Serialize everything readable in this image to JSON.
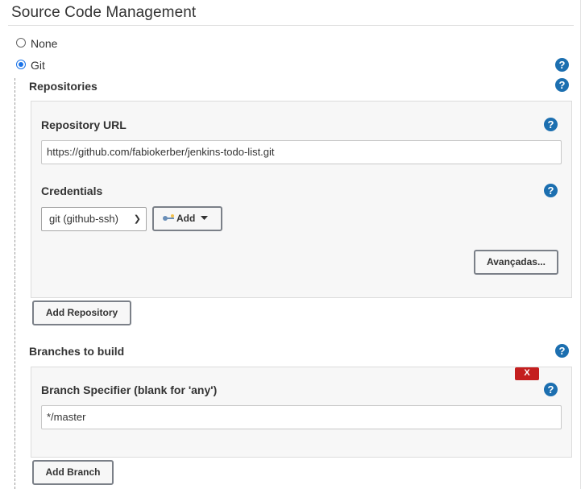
{
  "section": {
    "title": "Source Code Management"
  },
  "scm": {
    "none_label": "None",
    "git_label": "Git",
    "selected": "Git"
  },
  "repositories": {
    "label": "Repositories",
    "url_label": "Repository URL",
    "url_value": "https://github.com/fabiokerber/jenkins-todo-list.git",
    "credentials_label": "Credentials",
    "credentials_selected": "git (github-ssh)",
    "add_label": "Add",
    "advanced_label": "Avançadas...",
    "add_repository_label": "Add Repository"
  },
  "branches": {
    "label": "Branches to build",
    "specifier_label": "Branch Specifier (blank for 'any')",
    "specifier_value": "*/master",
    "delete_label": "X",
    "add_branch_label": "Add Branch"
  },
  "colors": {
    "help": "#1c6fb0",
    "delete": "#c41f1f",
    "radio_accent": "#1a73e8"
  },
  "icons": [
    "help-icon",
    "key-icon",
    "caret-down-icon",
    "chevron-down-icon"
  ]
}
